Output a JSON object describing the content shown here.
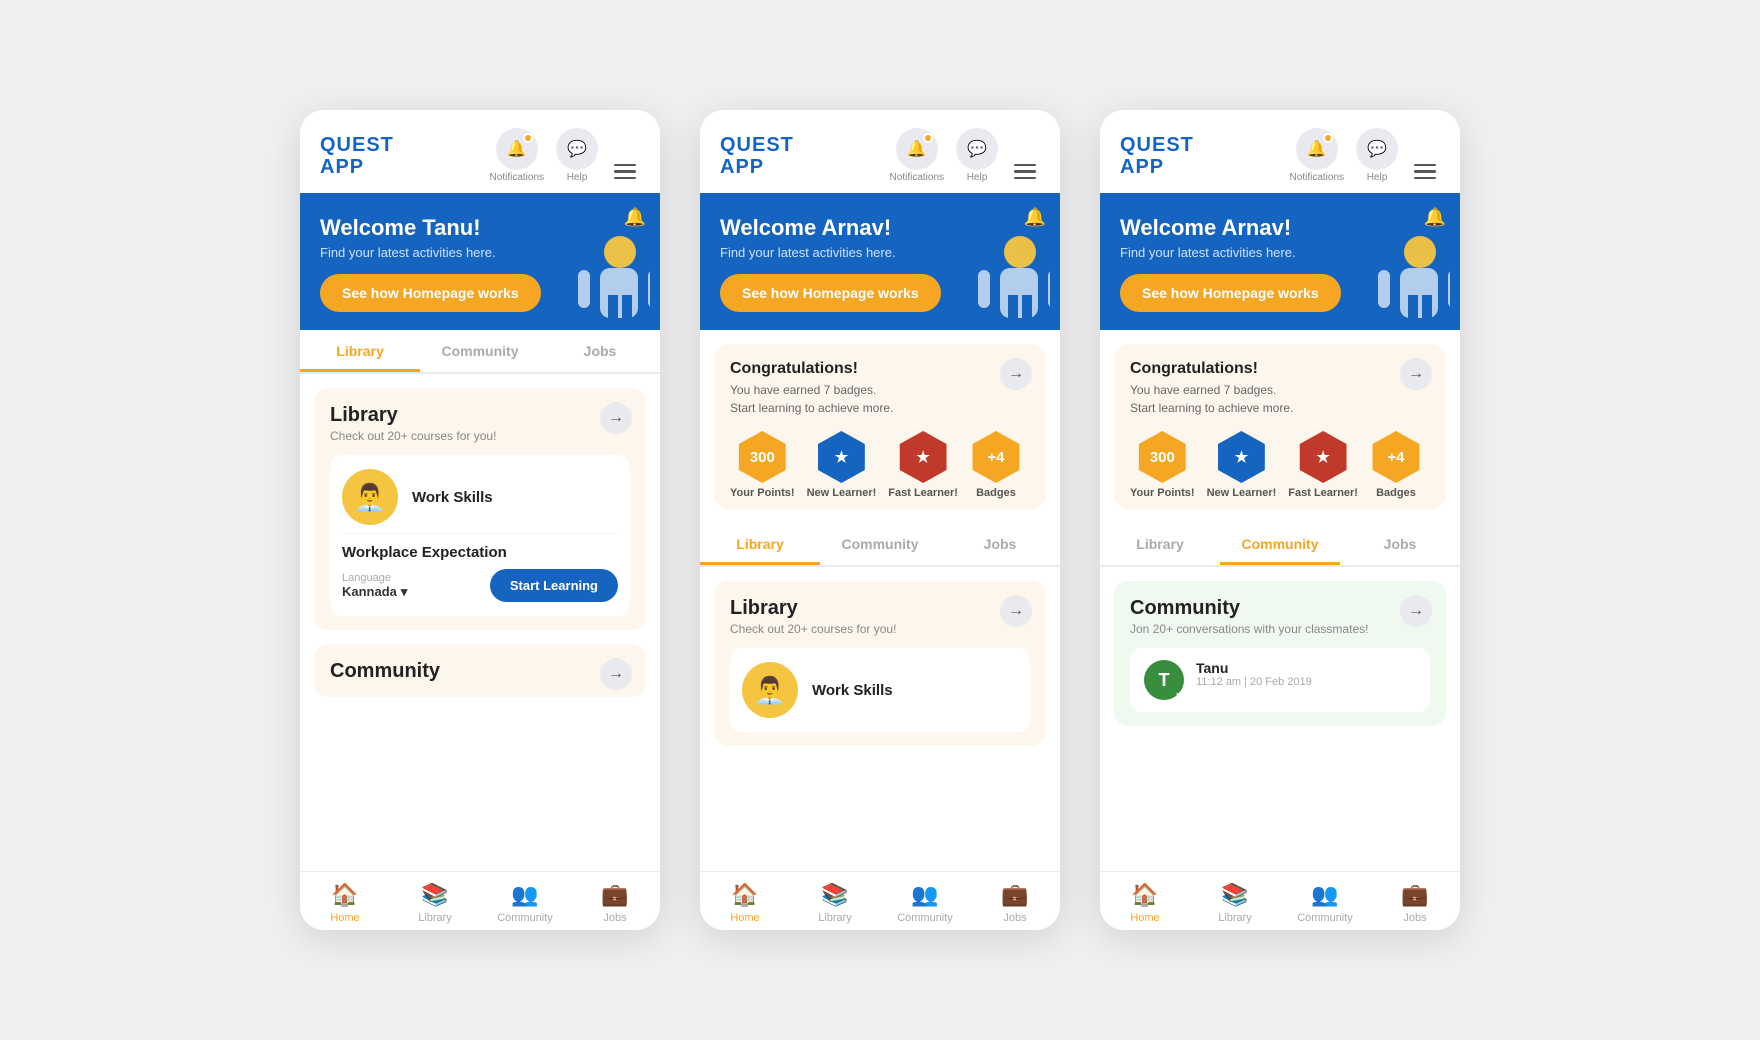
{
  "screens": [
    {
      "id": "screen1",
      "header": {
        "logo_line1": "QUEST",
        "logo_line2": "APP",
        "notifications_label": "Notifications",
        "help_label": "Help"
      },
      "banner": {
        "title": "Welcome Tanu!",
        "subtitle": "Find your latest activities here.",
        "button": "See how Homepage works"
      },
      "tabs": [
        {
          "label": "Library",
          "active": true
        },
        {
          "label": "Community",
          "active": false
        },
        {
          "label": "Jobs",
          "active": false
        }
      ],
      "library_section": {
        "title": "Library",
        "subtitle": "Check out 20+ courses for you!",
        "arrow": "→"
      },
      "course": {
        "name": "Work Skills",
        "title": "Workplace Expectation",
        "lang_label": "Language",
        "lang_value": "Kannada",
        "start_btn": "Start Learning"
      },
      "community_partial": {
        "title": "Community",
        "arrow": "→"
      },
      "bottom_nav": [
        {
          "label": "Home",
          "active": true
        },
        {
          "label": "Library",
          "active": false
        },
        {
          "label": "Community",
          "active": false
        },
        {
          "label": "Jobs",
          "active": false
        }
      ]
    },
    {
      "id": "screen2",
      "header": {
        "logo_line1": "QUEST",
        "logo_line2": "APP",
        "notifications_label": "Notifications",
        "help_label": "Help"
      },
      "banner": {
        "title": "Welcome Arnav!",
        "subtitle": "Find your latest activities here.",
        "button": "See how Homepage works"
      },
      "congrats": {
        "title": "Congratulations!",
        "line1": "You have earned 7 badges.",
        "line2": "Start learning to achieve more.",
        "arrow": "→",
        "badges": [
          {
            "label1": "Your",
            "label2": "Points!",
            "value": "300",
            "color": "orange"
          },
          {
            "label1": "New",
            "label2": "Learner!",
            "value": "★",
            "color": "blue"
          },
          {
            "label1": "Fast",
            "label2": "Learner!",
            "value": "★",
            "color": "red"
          },
          {
            "label1": "Badges",
            "label2": "",
            "value": "+4",
            "color": "orange2"
          }
        ]
      },
      "tabs": [
        {
          "label": "Library",
          "active": true
        },
        {
          "label": "Community",
          "active": false
        },
        {
          "label": "Jobs",
          "active": false
        }
      ],
      "library_section": {
        "title": "Library",
        "subtitle": "Check out 20+ courses for you!",
        "arrow": "→"
      },
      "course": {
        "name": "Work Skills"
      },
      "bottom_nav": [
        {
          "label": "Home",
          "active": true
        },
        {
          "label": "Library",
          "active": false
        },
        {
          "label": "Community",
          "active": false
        },
        {
          "label": "Jobs",
          "active": false
        }
      ]
    },
    {
      "id": "screen3",
      "header": {
        "logo_line1": "QUEST",
        "logo_line2": "APP",
        "notifications_label": "Notifications",
        "help_label": "Help"
      },
      "banner": {
        "title": "Welcome Arnav!",
        "subtitle": "Find your latest activities here.",
        "button": "See how Homepage works"
      },
      "congrats": {
        "title": "Congratulations!",
        "line1": "You have earned 7 badges.",
        "line2": "Start learning to achieve more.",
        "arrow": "→",
        "badges": [
          {
            "label1": "Your",
            "label2": "Points!",
            "value": "300",
            "color": "orange"
          },
          {
            "label1": "New",
            "label2": "Learner!",
            "value": "★",
            "color": "blue"
          },
          {
            "label1": "Fast",
            "label2": "Learner!",
            "value": "★",
            "color": "red"
          },
          {
            "label1": "Badges",
            "label2": "",
            "value": "+4",
            "color": "orange2"
          }
        ]
      },
      "tabs": [
        {
          "label": "Library",
          "active": false
        },
        {
          "label": "Community",
          "active": true
        },
        {
          "label": "Jobs",
          "active": false
        }
      ],
      "community_section": {
        "title": "Community",
        "subtitle": "Jon 20+ conversations with your classmates!",
        "arrow": "→"
      },
      "chat": {
        "avatar_letter": "T",
        "name": "Tanu",
        "time": "11:12 am | 20 Feb 2019"
      },
      "bottom_nav": [
        {
          "label": "Home",
          "active": true
        },
        {
          "label": "Library",
          "active": false
        },
        {
          "label": "Community",
          "active": false
        },
        {
          "label": "Jobs",
          "active": false
        }
      ]
    }
  ]
}
